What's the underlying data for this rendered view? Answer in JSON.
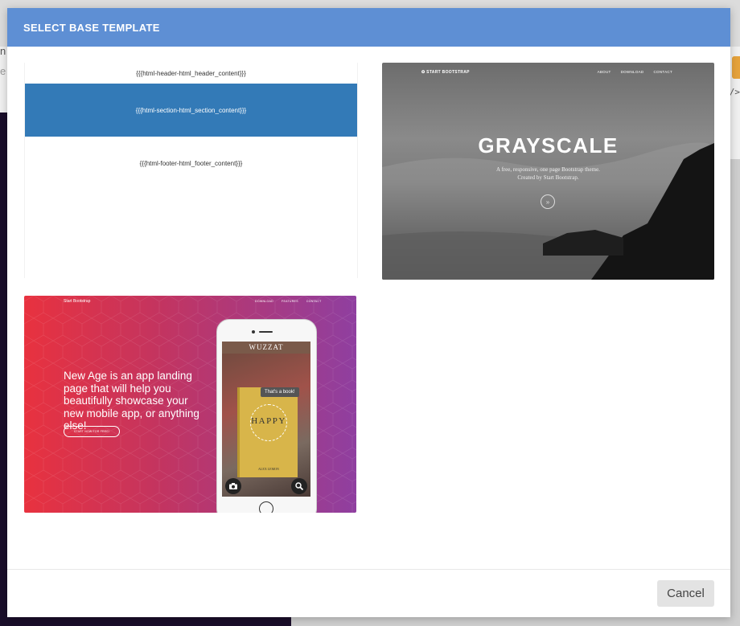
{
  "modal": {
    "title": "SELECT BASE TEMPLATE",
    "cancel_label": "Cancel"
  },
  "background": {
    "left_text_top": "n",
    "left_text_bottom": "e",
    "code_icon": "</>"
  },
  "templates": {
    "blank": {
      "header": "{{{html-header-html_header_content}}}",
      "section": "{{{html-section-html_section_content}}}",
      "footer": "{{{html-footer-html_footer_content}}}"
    },
    "grayscale": {
      "brand": "✪ START BOOTSTRAP",
      "nav": [
        "ABOUT",
        "DOWNLOAD",
        "CONTACT"
      ],
      "title": "GRAYSCALE",
      "subtitle_line1": "A free, responsive, one page Bootstrap theme.",
      "subtitle_line2": "Created by Start Bootstrap."
    },
    "new_age": {
      "brand": "Start Bootstrap",
      "nav": [
        "DOWNLOAD",
        "FEATURES",
        "CONTACT"
      ],
      "headline": "New Age is an app landing page that will help you beautifully showcase your new mobile app, or anything else!",
      "button": "START NOW FOR FREE!",
      "app_name": "WUZZAT",
      "bubble": "That's a book!",
      "book_title": "HAPPY",
      "book_author": "ALEX LEMON"
    }
  },
  "colors": {
    "header_bg": "#5e8fd4",
    "section_bg": "#337ab7"
  }
}
